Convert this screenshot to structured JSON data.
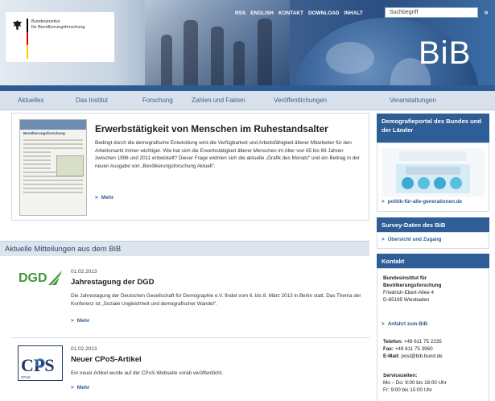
{
  "header": {
    "logo_text_line1": "Bundesinstitut",
    "logo_text_line2": "für Bevölkerungsforschung",
    "brand": "BiB",
    "toplinks": [
      "RSS",
      "ENGLISH",
      "KONTAKT",
      "DOWNLOAD",
      "INHALT"
    ],
    "search_placeholder": "Suchbegriff",
    "search_button": "»"
  },
  "nav": [
    "Aktuelles",
    "Das Institut",
    "Forschung",
    "Zahlen und Fakten",
    "Veröffentlichungen",
    "Veranstaltungen"
  ],
  "featured": {
    "title": "Erwerbstätigkeit von Menschen im Ruhestandsalter",
    "text": "Bedingt durch die demografische Entwicklung wird die Verfügbarkeit und Arbeitsfähigkeit älterer Mitarbeiter für den Arbeitsmarkt immer wichtiger. Wie hat sich die Erwerbstätigkeit älterer Menschen im Alter von 65 bis 69 Jahren zwischen 1996 und 2011 entwickelt? Dieser Frage widmen sich die aktuelle „Grafik des Monats“ und ein Beitrag in der neuen Ausgabe von „Bevölkerungsforschung Aktuell“.",
    "more": "Mehr",
    "thumb_title": "Bevölkerungsforschung"
  },
  "section_title": "Aktuelle Mitteilungen aus dem BiB",
  "news": [
    {
      "logo": "DGD",
      "date": "01.02.2013",
      "title": "Jahrestagung der DGD",
      "text": "Die Jahrestagung der Deutschen Gesellschaft für Demographie e.V. findet vom 6. bis 8. März 2013 in Berlin statt. Das Thema der Konferenz ist „Soziale Ungleichheit und demografischer Wandel“.",
      "more": "Mehr"
    },
    {
      "logo": "CPoS",
      "date": "01.02.2013",
      "title": "Neuer CPoS-Artikel",
      "text": "Ein neuer Artikel wurde auf der CPoS-Webseite vorab veröffentlicht.",
      "more": "Mehr"
    }
  ],
  "sidebar": {
    "portal": {
      "title": "Demografieportal des Bundes und der Länder",
      "link": "politik-für-alle-generationen.de"
    },
    "survey": {
      "title": "Survey-Daten des BiB",
      "link": "Übersicht und Zugang"
    },
    "contact": {
      "title": "Kontakt",
      "org_line1": "Bundesinstitut für",
      "org_line2": "Bevölkerungsforschung",
      "street": "Friedrich-Ebert-Allee 4",
      "city": "D-65185 Wiesbaden",
      "route_link": "Anfahrt zum BiB",
      "phone_label": "Telefon:",
      "phone": "+49 611 75 2235",
      "fax_label": "Fax:",
      "fax": "+49 611 75 3960",
      "email_label": "E-Mail:",
      "email": "post@bib.bund.de",
      "hours_label": "Servicezeiten:",
      "hours1": "Mo – Do: 9:00 bis 16:00 Uhr",
      "hours2": "Fr: 9:00 bis 15:00 Uhr"
    }
  },
  "colors": {
    "primary": "#2f5d95",
    "nav_bg": "#d9e2ec",
    "link": "#2d5b94",
    "dgd_green": "#3f9a3a",
    "cpos_blue": "#23366a"
  }
}
